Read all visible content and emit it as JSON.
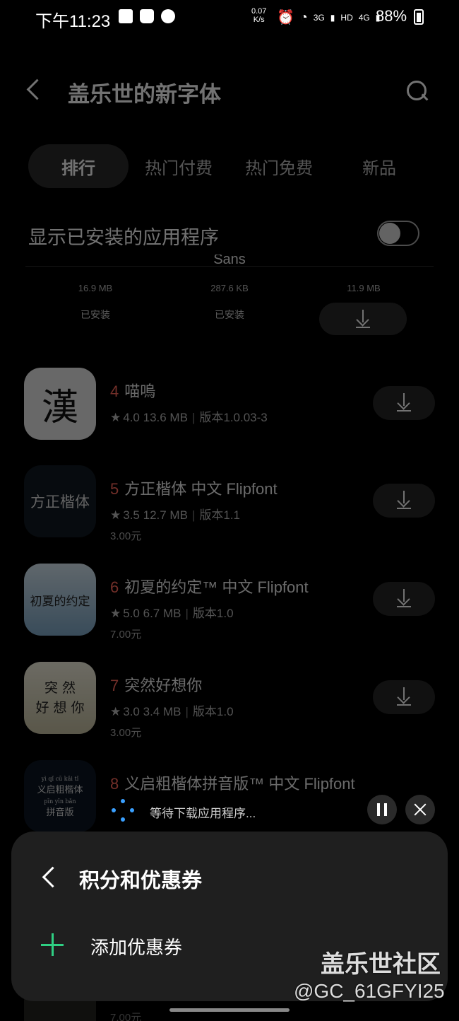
{
  "status_bar": {
    "time": "下午11:23",
    "net_speed_value": "0.07",
    "net_speed_unit": "K/s",
    "net_3g": "3G",
    "net_hd": "HD",
    "net_4g": "4G",
    "battery": "88%"
  },
  "header": {
    "title": "盖乐世的新字体",
    "icons": [
      "back-icon",
      "search-icon"
    ]
  },
  "tabs": [
    {
      "label": "排行",
      "active": true
    },
    {
      "label": "热门付费",
      "active": false
    },
    {
      "label": "热门免费",
      "active": false
    },
    {
      "label": "新品",
      "active": false
    }
  ],
  "installed_toggle": {
    "label": "显示已安装的应用程序",
    "on": false
  },
  "top_grid": [
    {
      "name": "",
      "size": "16.9 MB",
      "state": "已安装"
    },
    {
      "name": "Sans",
      "size": "287.6 KB",
      "state": "已安装"
    },
    {
      "name": "",
      "size": "11.9 MB",
      "state": ""
    }
  ],
  "apps": [
    {
      "rank": "4",
      "title": "喵嗚",
      "rating": "4.0",
      "size": "13.6 MB",
      "version": "版本1.0.03-3",
      "price": "",
      "thumb_text": "漢"
    },
    {
      "rank": "5",
      "title": "方正楷体 中文 Flipfont",
      "rating": "3.5",
      "size": "12.7 MB",
      "version": "版本1.1",
      "price": "3.00元",
      "thumb_text": "方正楷体"
    },
    {
      "rank": "6",
      "title": "初夏的约定™ 中文 Flipfont",
      "rating": "5.0",
      "size": "6.7 MB",
      "version": "版本1.0",
      "price": "7.00元",
      "thumb_text": "初夏的约定"
    },
    {
      "rank": "7",
      "title": "突然好想你",
      "rating": "3.0",
      "size": "3.4 MB",
      "version": "版本1.0",
      "price": "3.00元",
      "thumb_line1": "突 然",
      "thumb_line2": "好 想 你"
    },
    {
      "rank": "8",
      "title": "义启粗楷体拼音版™ 中文 Flipfont",
      "thumb_py1": "yì qǐ cū kǎi tǐ",
      "thumb_hz1": "义启粗楷体",
      "thumb_py2": "pīn yīn bǎn",
      "thumb_hz2": "拼音版"
    }
  ],
  "download_progress": {
    "text": "等待下载应用程序...",
    "icons": [
      "spinner-icon",
      "pause-icon",
      "close-icon"
    ]
  },
  "sheet": {
    "title": "积分和优惠券",
    "add_label": "添加优惠券",
    "accent": "#2fcf83"
  },
  "below_sheet_price": "7.00元",
  "watermark": {
    "brand": "盖乐世社区",
    "user": "@GC_61GFYI25"
  },
  "colors": {
    "rank": "#ff6a5c",
    "background": "#000000",
    "sheet_bg": "#1f1f1f"
  }
}
